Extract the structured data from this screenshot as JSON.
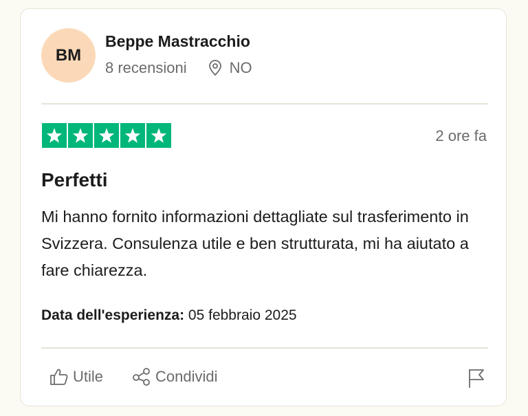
{
  "reviewer": {
    "initials": "BM",
    "name": "Beppe Mastracchio",
    "reviews_count": "8 recensioni",
    "country": "NO",
    "avatar_color": "#fbd9b8"
  },
  "review": {
    "rating": 5,
    "star_color": "#00b67a",
    "time_ago": "2 ore fa",
    "title": "Perfetti",
    "body": "Mi hanno fornito informazioni dettagliate sul trasferimento in Svizzera. Consulenza utile e ben strutturata, mi ha aiutato a fare chiarezza.",
    "experience_label": "Data dell'esperienza:",
    "experience_date": "05 febbraio 2025"
  },
  "actions": {
    "useful_label": "Utile",
    "useful_icon": "thumbs-up-icon",
    "share_label": "Condividi",
    "share_icon": "share-icon",
    "report_icon": "flag-icon"
  }
}
